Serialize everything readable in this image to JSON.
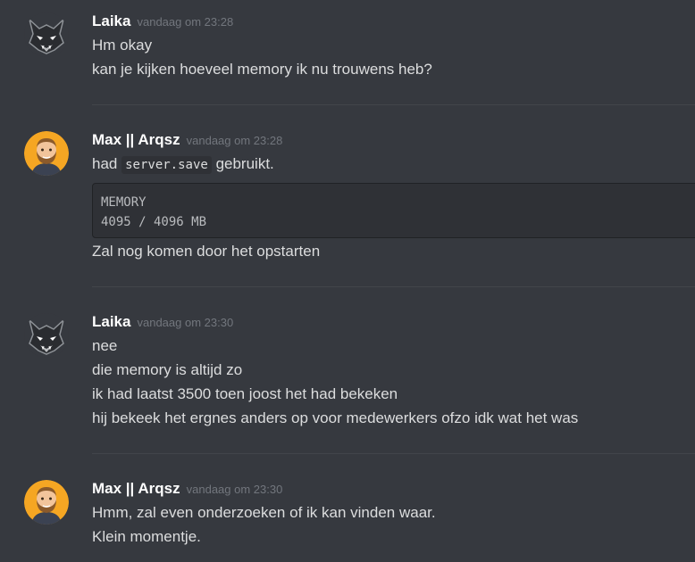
{
  "messages": [
    {
      "author": "Laika",
      "timestamp": "vandaag om 23:28",
      "lines": [
        "Hm okay",
        "kan je kijken hoeveel memory ik nu trouwens heb?"
      ]
    },
    {
      "author": "Max || Arqsz",
      "timestamp": "vandaag om 23:28",
      "line1_before": "had",
      "line1_code": "server.save",
      "line1_after": "gebruikt.",
      "code_block": [
        "MEMORY",
        "4095 / 4096 MB"
      ],
      "line_after_code": "Zal nog komen door het opstarten"
    },
    {
      "author": "Laika",
      "timestamp": "vandaag om 23:30",
      "lines": [
        "nee",
        "die memory is altijd zo",
        "ik had laatst 3500 toen joost het had bekeken",
        "hij bekeek het ergnes anders op voor medewerkers ofzo idk wat het was"
      ]
    },
    {
      "author": "Max || Arqsz",
      "timestamp": "vandaag om 23:30",
      "lines": [
        "Hmm, zal even onderzoeken of ik kan vinden waar.",
        "Klein momentje."
      ]
    }
  ],
  "colors": {
    "background": "#36393f",
    "username": "#ffffff",
    "timestamp": "#72767d",
    "text": "#dcddde",
    "code_background": "#2f3136"
  },
  "icons": {
    "laika_avatar": "wolf-avatar-icon",
    "max_avatar": "bearded-man-avatar-icon"
  }
}
